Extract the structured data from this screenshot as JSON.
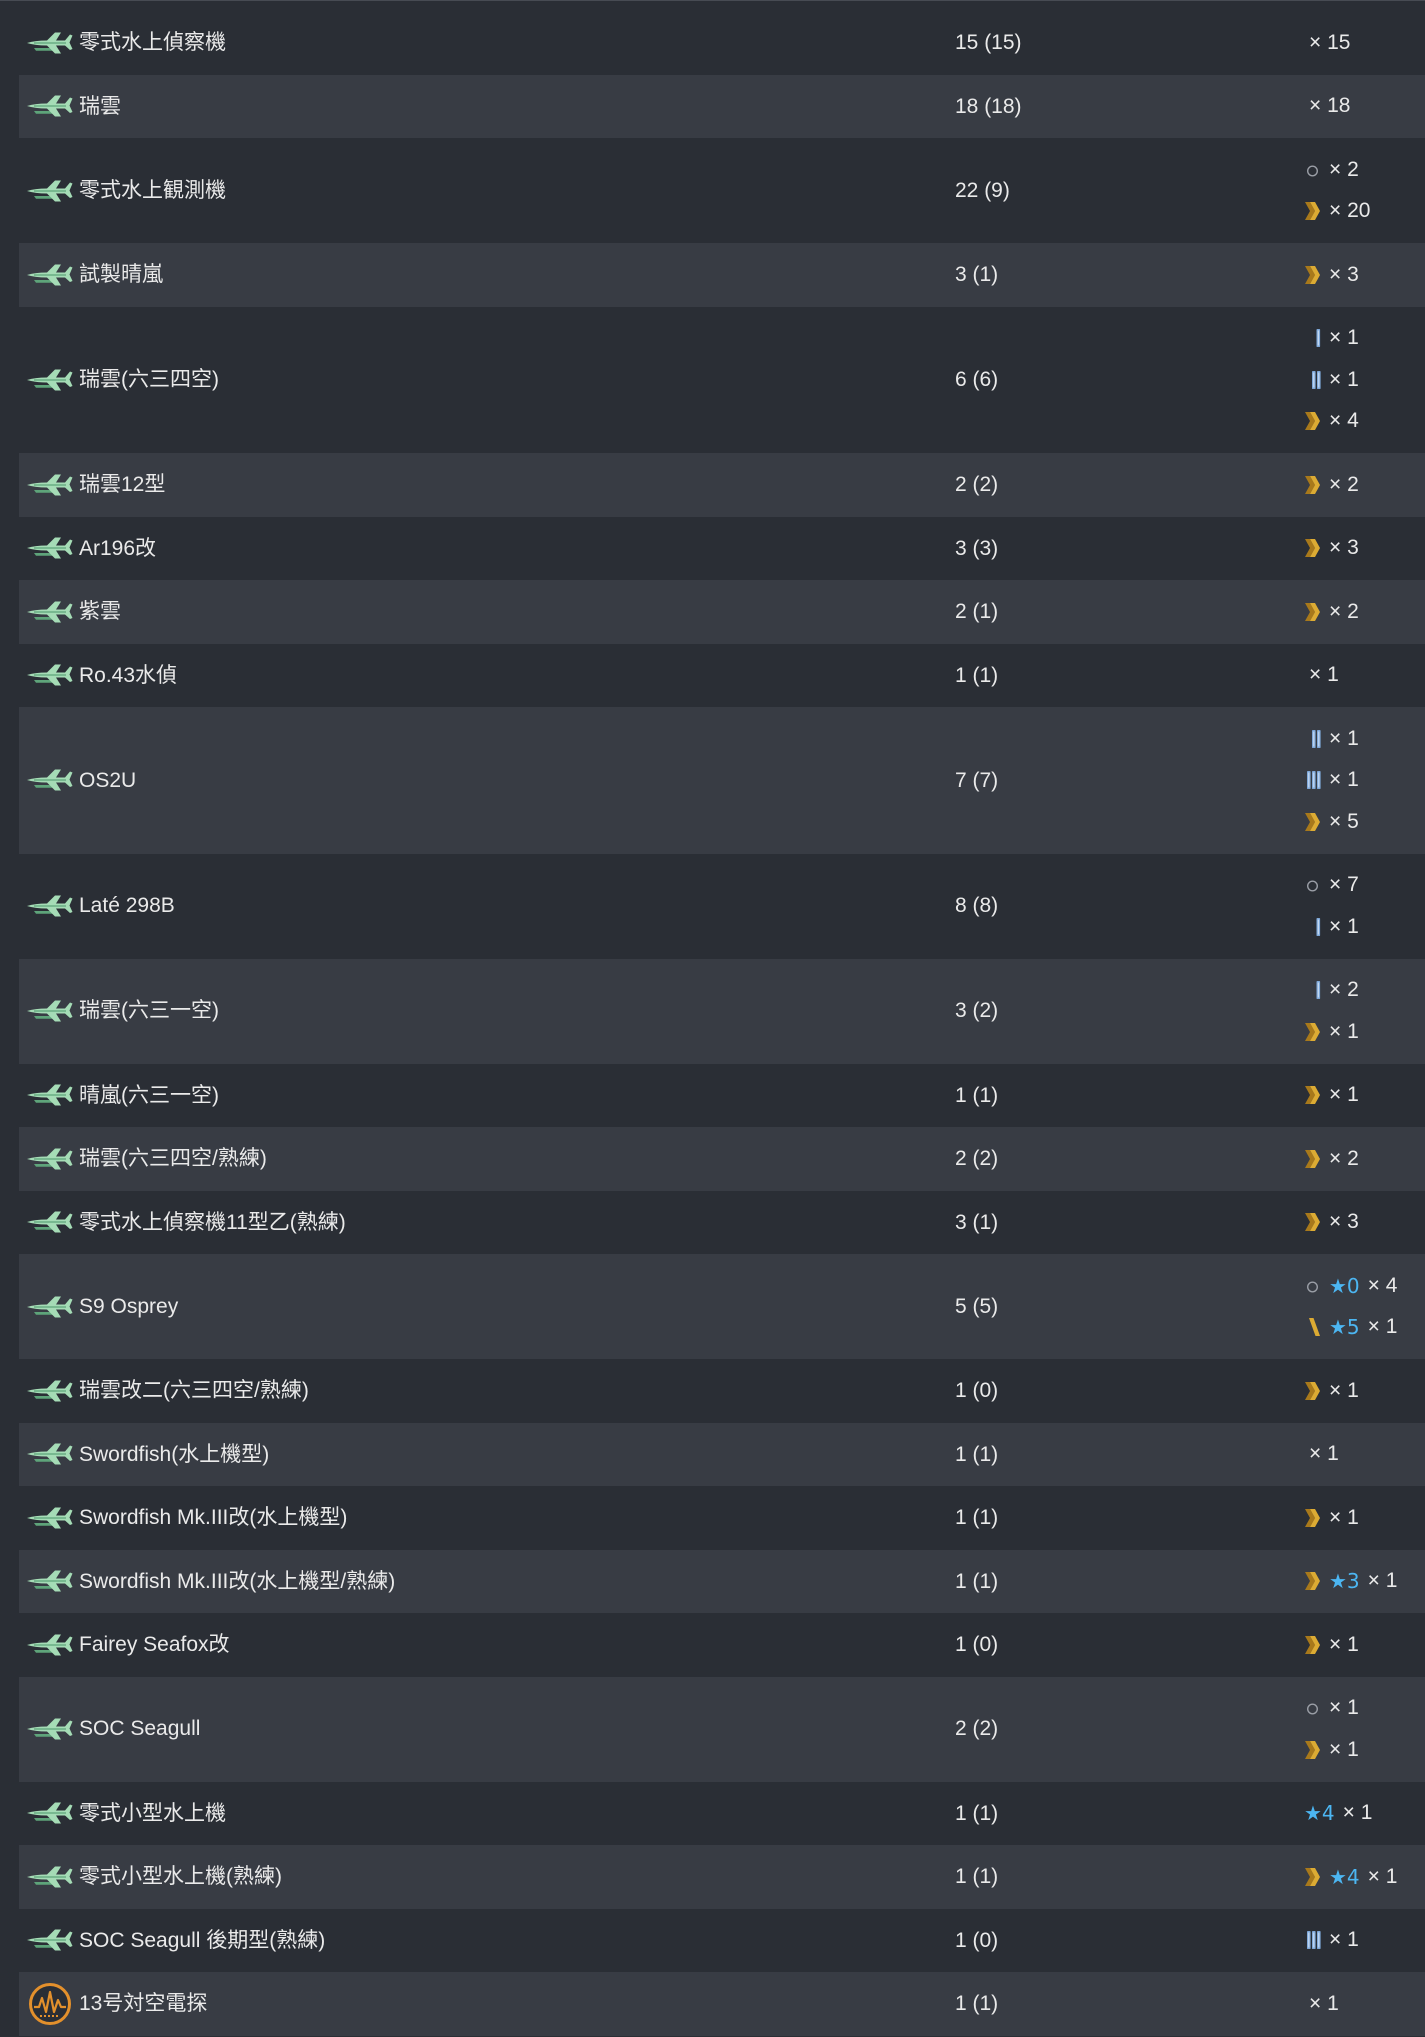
{
  "colors": {
    "background": "#2a2e35",
    "row_stripe": "#383c44",
    "text": "#eaeaea",
    "improvement_star": "#4cb6f2",
    "proficiency_gold": "#dcab33",
    "proficiency_blue": "#7fa9da",
    "proficiency_zero": "#9a9ea6",
    "seaplane_icon": "#a5dcb6",
    "seaplane_icon_dark": "#5ea47a",
    "radar_icon": "#e3902c"
  },
  "rows": [
    {
      "icon": "seaplane-icon",
      "name": "零式水上偵察機",
      "count": "15 (15)",
      "prof": [
        {
          "qty": "× 15"
        }
      ]
    },
    {
      "icon": "seaplane-icon",
      "name": "瑞雲",
      "count": "18 (18)",
      "prof": [
        {
          "qty": "× 18"
        }
      ]
    },
    {
      "icon": "seaplane-icon",
      "name": "零式水上観測機",
      "count": "22 (9)",
      "prof": [
        {
          "icon": "proficiency-zero-icon",
          "qty": "× 2"
        },
        {
          "icon": "proficiency-max-icon",
          "qty": "× 20"
        }
      ]
    },
    {
      "icon": "seaplane-icon",
      "name": "試製晴嵐",
      "count": "3 (1)",
      "prof": [
        {
          "icon": "proficiency-max-icon",
          "qty": "× 3"
        }
      ]
    },
    {
      "icon": "seaplane-icon",
      "name": "瑞雲(六三四空)",
      "count": "6 (6)",
      "prof": [
        {
          "icon": "proficiency-1-icon",
          "qty": "× 1"
        },
        {
          "icon": "proficiency-2-icon",
          "qty": "× 1"
        },
        {
          "icon": "proficiency-max-icon",
          "qty": "× 4"
        }
      ]
    },
    {
      "icon": "seaplane-icon",
      "name": "瑞雲12型",
      "count": "2 (2)",
      "prof": [
        {
          "icon": "proficiency-max-icon",
          "qty": "× 2"
        }
      ]
    },
    {
      "icon": "seaplane-icon",
      "name": "Ar196改",
      "count": "3 (3)",
      "prof": [
        {
          "icon": "proficiency-max-icon",
          "qty": "× 3"
        }
      ]
    },
    {
      "icon": "seaplane-icon",
      "name": "紫雲",
      "count": "2 (1)",
      "prof": [
        {
          "icon": "proficiency-max-icon",
          "qty": "× 2"
        }
      ]
    },
    {
      "icon": "seaplane-icon",
      "name": "Ro.43水偵",
      "count": "1 (1)",
      "prof": [
        {
          "qty": "× 1"
        }
      ]
    },
    {
      "icon": "seaplane-icon",
      "name": "OS2U",
      "count": "7 (7)",
      "prof": [
        {
          "icon": "proficiency-2-icon",
          "qty": "× 1"
        },
        {
          "icon": "proficiency-3-icon",
          "qty": "× 1"
        },
        {
          "icon": "proficiency-max-icon",
          "qty": "× 5"
        }
      ]
    },
    {
      "icon": "seaplane-icon",
      "name": "Laté 298B",
      "count": "8 (8)",
      "prof": [
        {
          "icon": "proficiency-zero-icon",
          "qty": "× 7"
        },
        {
          "icon": "proficiency-1-icon",
          "qty": "× 1"
        }
      ]
    },
    {
      "icon": "seaplane-icon",
      "name": "瑞雲(六三一空)",
      "count": "3 (2)",
      "prof": [
        {
          "icon": "proficiency-1-icon",
          "qty": "× 2"
        },
        {
          "icon": "proficiency-max-icon",
          "qty": "× 1"
        }
      ]
    },
    {
      "icon": "seaplane-icon",
      "name": "晴嵐(六三一空)",
      "count": "1 (1)",
      "prof": [
        {
          "icon": "proficiency-max-icon",
          "qty": "× 1"
        }
      ]
    },
    {
      "icon": "seaplane-icon",
      "name": "瑞雲(六三四空/熟練)",
      "count": "2 (2)",
      "prof": [
        {
          "icon": "proficiency-max-icon",
          "qty": "× 2"
        }
      ]
    },
    {
      "icon": "seaplane-icon",
      "name": "零式水上偵察機11型乙(熟練)",
      "count": "3 (1)",
      "prof": [
        {
          "icon": "proficiency-max-icon",
          "qty": "× 3"
        }
      ]
    },
    {
      "icon": "seaplane-icon",
      "name": "S9 Osprey",
      "count": "5 (5)",
      "prof": [
        {
          "icon": "proficiency-zero-icon",
          "star": "★0",
          "qty": "× 4"
        },
        {
          "icon": "proficiency-4-icon",
          "star": "★5",
          "qty": "× 1"
        }
      ]
    },
    {
      "icon": "seaplane-icon",
      "name": "瑞雲改二(六三四空/熟練)",
      "count": "1 (0)",
      "prof": [
        {
          "icon": "proficiency-max-icon",
          "qty": "× 1"
        }
      ]
    },
    {
      "icon": "seaplane-icon",
      "name": "Swordfish(水上機型)",
      "count": "1 (1)",
      "prof": [
        {
          "qty": "× 1"
        }
      ]
    },
    {
      "icon": "seaplane-icon",
      "name": "Swordfish Mk.III改(水上機型)",
      "count": "1 (1)",
      "prof": [
        {
          "icon": "proficiency-max-icon",
          "qty": "× 1"
        }
      ]
    },
    {
      "icon": "seaplane-icon",
      "name": "Swordfish Mk.III改(水上機型/熟練)",
      "count": "1 (1)",
      "prof": [
        {
          "icon": "proficiency-max-icon",
          "star": "★3",
          "qty": "× 1"
        }
      ]
    },
    {
      "icon": "seaplane-icon",
      "name": "Fairey Seafox改",
      "count": "1 (0)",
      "prof": [
        {
          "icon": "proficiency-max-icon",
          "qty": "× 1"
        }
      ]
    },
    {
      "icon": "seaplane-icon",
      "name": "SOC Seagull",
      "count": "2 (2)",
      "prof": [
        {
          "icon": "proficiency-zero-icon",
          "qty": "× 1"
        },
        {
          "icon": "proficiency-max-icon",
          "qty": "× 1"
        }
      ]
    },
    {
      "icon": "seaplane-icon",
      "name": "零式小型水上機",
      "count": "1 (1)",
      "prof": [
        {
          "star": "★4",
          "qty": "× 1"
        }
      ]
    },
    {
      "icon": "seaplane-icon",
      "name": "零式小型水上機(熟練)",
      "count": "1 (1)",
      "prof": [
        {
          "icon": "proficiency-max-icon",
          "star": "★4",
          "qty": "× 1"
        }
      ]
    },
    {
      "icon": "seaplane-icon",
      "name": "SOC Seagull 後期型(熟練)",
      "count": "1 (0)",
      "prof": [
        {
          "icon": "proficiency-3-icon",
          "qty": "× 1"
        }
      ]
    },
    {
      "icon": "radar-icon",
      "name": "13号対空電探",
      "count": "1 (1)",
      "prof": [
        {
          "qty": "× 1"
        }
      ]
    }
  ]
}
